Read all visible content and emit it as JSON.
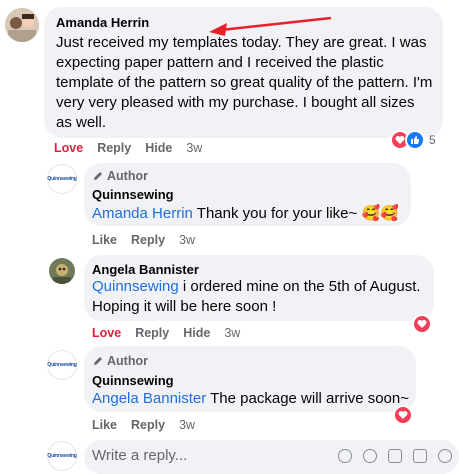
{
  "comments": [
    {
      "author": "Amanda Herrin",
      "text": "Just received my templates today. They are great. I was expecting paper pattern and I received the plastic template of the pattern so great quality of the pattern. I'm very very pleased with my purchase. I bought all sizes as well.",
      "actions": {
        "love": "Love",
        "reply": "Reply",
        "hide": "Hide",
        "time": "3w"
      },
      "reaction_count": "5",
      "reactions": [
        "heart-icon",
        "like-icon"
      ],
      "annotation_color": "#e8222a"
    },
    {
      "badge": "Author",
      "author": "Quinnsewing",
      "mention": "Amanda Herrin",
      "text": " Thank you for your like~ 🥰🥰",
      "actions": {
        "like": "Like",
        "reply": "Reply",
        "time": "3w"
      }
    },
    {
      "author": "Angela Bannister",
      "mention": "Quinnsewing",
      "text": " i ordered mine on the 5th of August. Hoping it will be here soon !",
      "actions": {
        "love": "Love",
        "reply": "Reply",
        "hide": "Hide",
        "time": "3w"
      },
      "reactions": [
        "heart-icon"
      ]
    },
    {
      "badge": "Author",
      "author": "Quinnsewing",
      "mention": "Angela Bannister",
      "text": " The package will arrive soon~",
      "actions": {
        "like": "Like",
        "reply": "Reply",
        "time": "3w"
      },
      "reactions": [
        "heart-icon"
      ]
    }
  ],
  "reply_box": {
    "placeholder": "Write a reply..."
  },
  "page_logo": "Quinnsewing",
  "colors": {
    "link": "#216fdb",
    "love": "#e41e3f",
    "bubble": "#f0f2f5",
    "muted": "#65676b"
  }
}
